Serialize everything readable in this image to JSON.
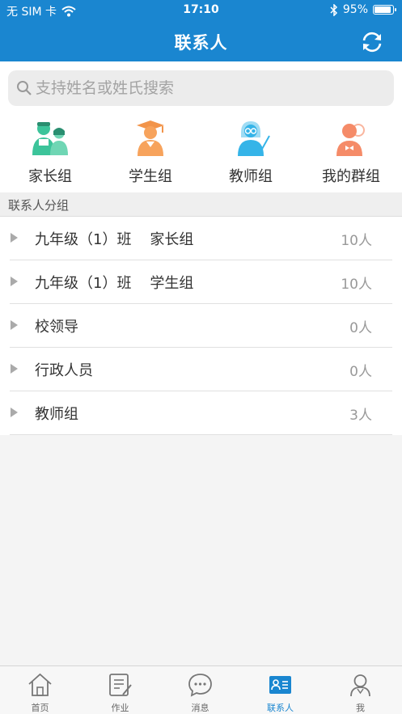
{
  "status": {
    "carrier": "无 SIM 卡",
    "time": "17:10",
    "battery": "95%",
    "battery_level": 0.95
  },
  "nav": {
    "title": "联系人"
  },
  "search": {
    "placeholder": "支持姓名或姓氏搜索"
  },
  "groups": [
    {
      "label": "家长组",
      "icon": "parents-icon",
      "color": "#3cc49a"
    },
    {
      "label": "学生组",
      "icon": "student-icon",
      "color": "#f7a35c"
    },
    {
      "label": "教师组",
      "icon": "teacher-icon",
      "color": "#35b4e8"
    },
    {
      "label": "我的群组",
      "icon": "my-group-icon",
      "color": "#f58b68"
    }
  ],
  "section": {
    "title": "联系人分组"
  },
  "list": [
    {
      "name": "九年级（1）班    家长组",
      "count": "10人"
    },
    {
      "name": "九年级（1）班    学生组",
      "count": "10人"
    },
    {
      "name": "校领导",
      "count": "0人"
    },
    {
      "name": "行政人员",
      "count": "0人"
    },
    {
      "name": "教师组",
      "count": "3人"
    }
  ],
  "tabs": [
    {
      "label": "首页",
      "icon": "home-icon"
    },
    {
      "label": "作业",
      "icon": "homework-icon"
    },
    {
      "label": "消息",
      "icon": "message-icon"
    },
    {
      "label": "联系人",
      "icon": "contacts-icon",
      "active": true
    },
    {
      "label": "我",
      "icon": "profile-icon"
    }
  ],
  "colors": {
    "primary": "#1a86d0"
  }
}
